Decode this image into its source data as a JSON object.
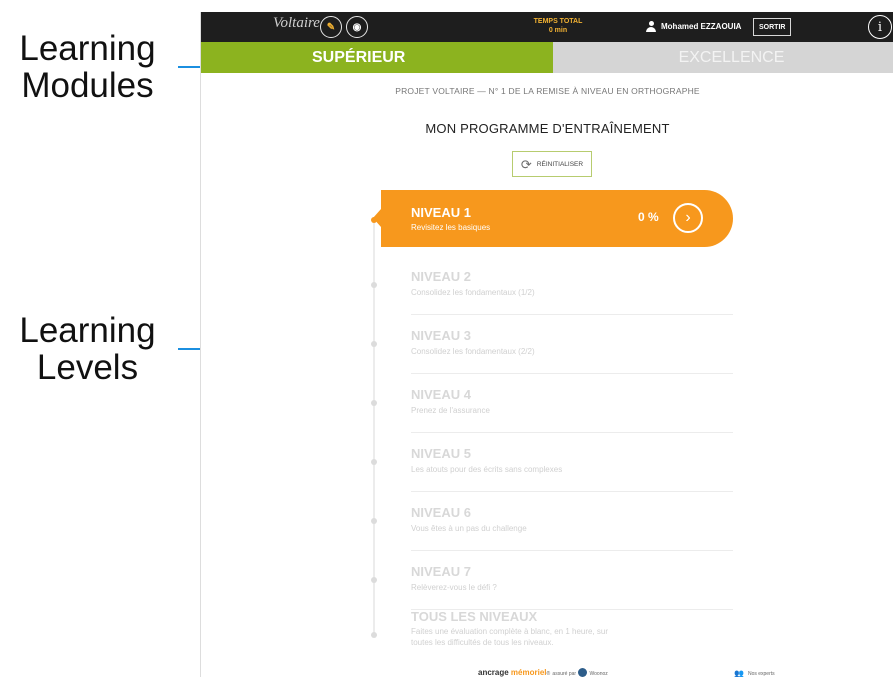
{
  "annotations": {
    "modules_line1": "Learning",
    "modules_line2": "Modules",
    "levels_line1": "Learning",
    "levels_line2": "Levels",
    "accent": "#1b8fe0"
  },
  "topbar": {
    "logo": "Voltaire",
    "timer_label": "TEMPS TOTAL",
    "timer_value": "0 min",
    "user_name": "Mohamed EZZAOUIA",
    "logout": "SORTIR",
    "info": "i",
    "icons": [
      "edit-icon",
      "eye-icon",
      "user-icon",
      "info-icon"
    ]
  },
  "modules": [
    {
      "label": "SUPÉRIEUR",
      "active": true,
      "color": "#8cb31f"
    },
    {
      "label": "EXCELLENCE",
      "active": false,
      "color": "#d5d5d5"
    }
  ],
  "page": {
    "subtitle": "PROJET VOLTAIRE — N° 1 DE LA REMISE À NIVEAU EN ORTHOGRAPHE",
    "program_title": "MON PROGRAMME D'ENTRAÎNEMENT",
    "reset_label": "RÉINITIALISER"
  },
  "levels": [
    {
      "name": "NIVEAU 1",
      "desc": "Revisitez les basiques",
      "progress": "0 %",
      "active": true,
      "color": "#f7981d"
    },
    {
      "name": "NIVEAU 2",
      "desc": "Consolidez les fondamentaux (1/2)"
    },
    {
      "name": "NIVEAU 3",
      "desc": "Consolidez les fondamentaux (2/2)"
    },
    {
      "name": "NIVEAU 4",
      "desc": "Prenez de l'assurance"
    },
    {
      "name": "NIVEAU 5",
      "desc": "Les atouts pour des écrits sans complexes"
    },
    {
      "name": "NIVEAU 6",
      "desc": "Vous êtes à un pas du challenge"
    },
    {
      "name": "NIVEAU 7",
      "desc": "Relèverez-vous le défi ?"
    },
    {
      "name": "TOUS LES NIVEAUX",
      "desc": "Faites une évaluation complète à blanc, en 1 heure, sur toutes les difficultés de tous les niveaux."
    }
  ],
  "footer": {
    "ancrage": "ancrage",
    "memoriel": "mémoriel",
    "reg": "®",
    "assure_par": "assuré par",
    "woonoz": "Woonoz",
    "experts": "Nos experts"
  }
}
